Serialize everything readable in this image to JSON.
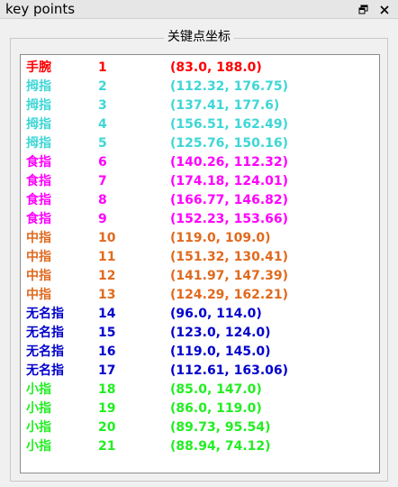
{
  "window": {
    "title": "key points"
  },
  "group": {
    "title": "关键点坐标"
  },
  "colors": {
    "wrist": "#ff0000",
    "thumb": "#3fd6d6",
    "index": "#ff00ff",
    "middle": "#e06a1e",
    "ring": "#0000cc",
    "pinky": "#22ee22"
  },
  "icons": {
    "float": "restore-window-icon",
    "close": "close-icon"
  },
  "rows": [
    {
      "name": "手腕",
      "index": "1",
      "coord": "(83.0, 188.0)",
      "color": "#ff0000"
    },
    {
      "name": "拇指",
      "index": "2",
      "coord": "(112.32, 176.75)",
      "color": "#3fd6d6"
    },
    {
      "name": "拇指",
      "index": "3",
      "coord": "(137.41, 177.6)",
      "color": "#3fd6d6"
    },
    {
      "name": "拇指",
      "index": "4",
      "coord": "(156.51, 162.49)",
      "color": "#3fd6d6"
    },
    {
      "name": "拇指",
      "index": "5",
      "coord": "(125.76, 150.16)",
      "color": "#3fd6d6"
    },
    {
      "name": "食指",
      "index": "6",
      "coord": "(140.26, 112.32)",
      "color": "#ff00ff"
    },
    {
      "name": "食指",
      "index": "7",
      "coord": "(174.18, 124.01)",
      "color": "#ff00ff"
    },
    {
      "name": "食指",
      "index": "8",
      "coord": "(166.77, 146.82)",
      "color": "#ff00ff"
    },
    {
      "name": "食指",
      "index": "9",
      "coord": "(152.23, 153.66)",
      "color": "#ff00ff"
    },
    {
      "name": "中指",
      "index": "10",
      "coord": "(119.0, 109.0)",
      "color": "#e06a1e"
    },
    {
      "name": "中指",
      "index": "11",
      "coord": "(151.32, 130.41)",
      "color": "#e06a1e"
    },
    {
      "name": "中指",
      "index": "12",
      "coord": "(141.97, 147.39)",
      "color": "#e06a1e"
    },
    {
      "name": "中指",
      "index": "13",
      "coord": "(124.29, 162.21)",
      "color": "#e06a1e"
    },
    {
      "name": "无名指",
      "index": "14",
      "coord": "(96.0, 114.0)",
      "color": "#0000cc"
    },
    {
      "name": "无名指",
      "index": "15",
      "coord": "(123.0, 124.0)",
      "color": "#0000cc"
    },
    {
      "name": "无名指",
      "index": "16",
      "coord": "(119.0, 145.0)",
      "color": "#0000cc"
    },
    {
      "name": "无名指",
      "index": "17",
      "coord": "(112.61, 163.06)",
      "color": "#0000cc"
    },
    {
      "name": "小指",
      "index": "18",
      "coord": "(85.0, 147.0)",
      "color": "#22ee22"
    },
    {
      "name": "小指",
      "index": "19",
      "coord": "(86.0, 119.0)",
      "color": "#22ee22"
    },
    {
      "name": "小指",
      "index": "20",
      "coord": "(89.73, 95.54)",
      "color": "#22ee22"
    },
    {
      "name": "小指",
      "index": "21",
      "coord": "(88.94, 74.12)",
      "color": "#22ee22"
    }
  ]
}
